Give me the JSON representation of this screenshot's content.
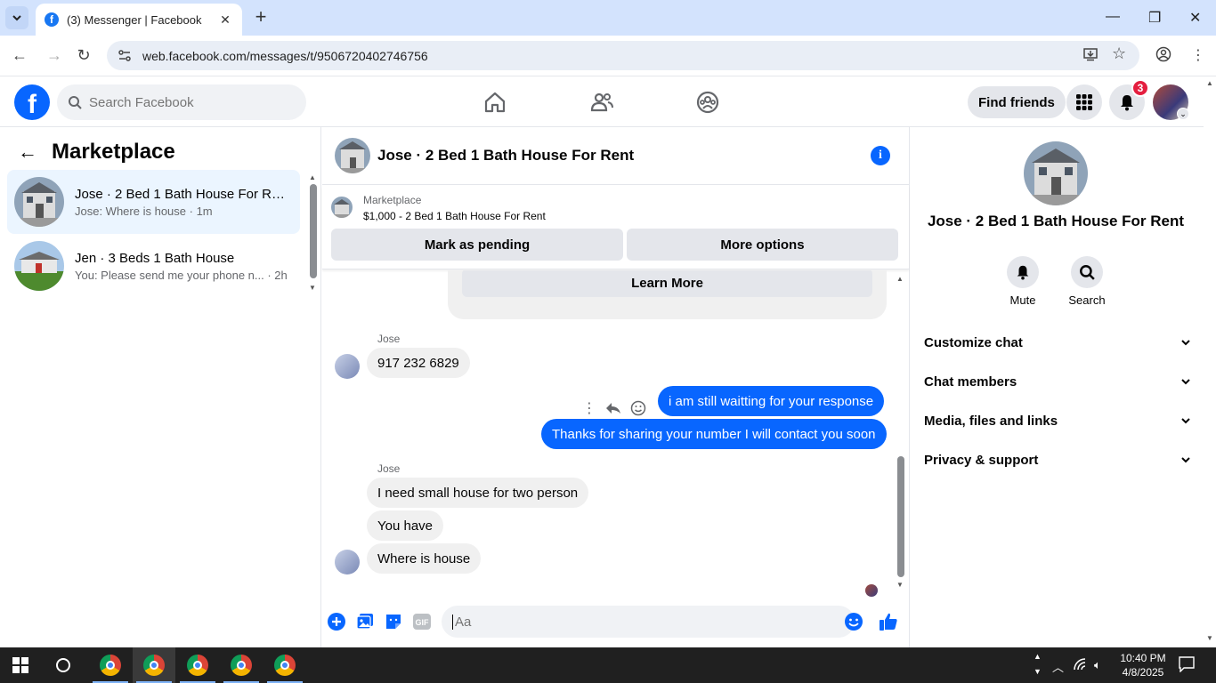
{
  "browser": {
    "tab_title": "(3) Messenger | Facebook",
    "url": "web.facebook.com/messages/t/9506720402746756"
  },
  "facebook": {
    "search_placeholder": "Search Facebook",
    "find_friends": "Find friends",
    "notification_count": "3"
  },
  "left": {
    "title": "Marketplace",
    "conversations": [
      {
        "name": "Jose · 2 Bed 1 Bath House For Re...",
        "preview": "Jose: Where is house",
        "time": "· 1m"
      },
      {
        "name": "Jen · 3 Beds 1 Bath House",
        "preview": "You: Please send me your phone n...",
        "time": "· 2h"
      }
    ]
  },
  "chat": {
    "title": "Jose · 2 Bed 1 Bath House For Rent",
    "marketplace_label": "Marketplace",
    "listing": "$1,000 - 2 Bed 1 Bath House For Rent",
    "mark_pending": "Mark as pending",
    "more_options": "More options",
    "learn_more": "Learn More",
    "sender_name": "Jose",
    "messages": [
      {
        "text": "917 232 6829"
      },
      {
        "text": "i am still waitting for your response"
      },
      {
        "text": "Thanks for sharing your number I will contact you soon"
      },
      {
        "text": "I need small house for two person"
      },
      {
        "text": "You have"
      },
      {
        "text": "Where is house"
      }
    ],
    "composer_placeholder": "Aa"
  },
  "right": {
    "title": "Jose · 2 Bed 1 Bath House For Rent",
    "actions": [
      {
        "label": "Mute"
      },
      {
        "label": "Search"
      }
    ],
    "sections": [
      {
        "label": "Customize chat"
      },
      {
        "label": "Chat members"
      },
      {
        "label": "Media, files and links"
      },
      {
        "label": "Privacy & support"
      }
    ]
  },
  "taskbar": {
    "time": "10:40 PM",
    "date": "4/8/2025"
  },
  "colors": {
    "brand": "#0866ff",
    "outgoing_bubble": "#0866ff",
    "incoming_bubble": "#f0f0f0",
    "badge": "#e41e3f"
  }
}
